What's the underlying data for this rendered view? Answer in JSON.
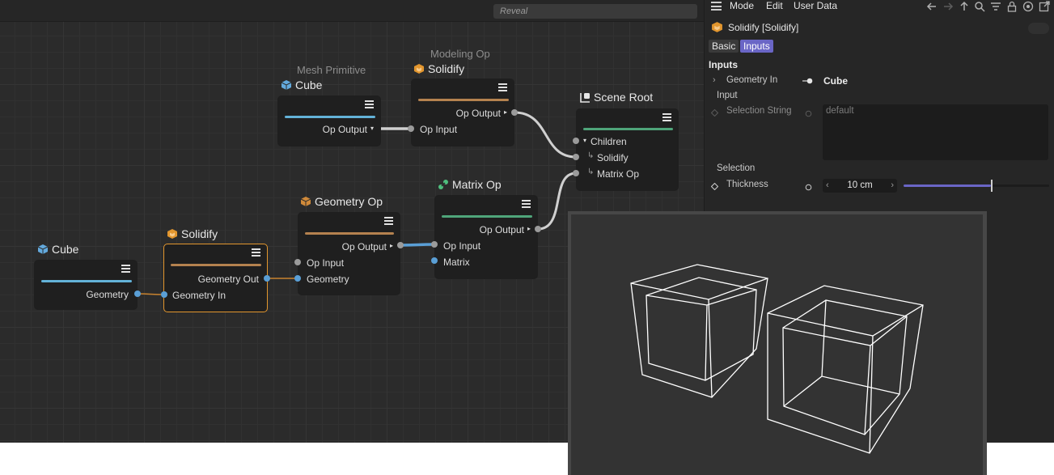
{
  "graph": {
    "reveal_label": "Reveal",
    "nodes": {
      "cube_left": {
        "title": "Cube",
        "outputs": [
          "Geometry"
        ]
      },
      "solidify_selected": {
        "title": "Solidify",
        "outputs": [
          "Geometry Out"
        ],
        "inputs": [
          "Geometry In"
        ]
      },
      "geometry_op": {
        "title": "Geometry Op",
        "outputs": [
          "Op Output"
        ],
        "inputs": [
          "Op Input",
          "Geometry"
        ]
      },
      "matrix_op": {
        "title": "Matrix Op",
        "outputs": [
          "Op Output"
        ],
        "inputs": [
          "Op Input",
          "Matrix"
        ]
      },
      "mesh_primitive": {
        "category": "Mesh Primitive",
        "title": "Cube",
        "outputs": [
          "Op Output"
        ]
      },
      "modeling_op": {
        "category": "Modeling Op",
        "title": "Solidify",
        "outputs": [
          "Op Output"
        ],
        "inputs": [
          "Op Input"
        ]
      },
      "scene_root": {
        "title": "Scene Root",
        "inputs": [
          "Children",
          "Solidify",
          "Matrix Op"
        ]
      }
    }
  },
  "attributes": {
    "menu": [
      "Mode",
      "Edit",
      "User Data"
    ],
    "toolbar_icons": [
      "back-arrow-icon",
      "forward-arrow-icon",
      "up-arrow-icon",
      "search-icon",
      "filter-icon",
      "lock-icon",
      "target-icon",
      "new-window-icon"
    ],
    "object_title": "Solidify [Solidify]",
    "tabs": [
      "Basic",
      "Inputs"
    ],
    "active_tab": "Inputs",
    "section_title": "Inputs",
    "geometry_in_label": "Geometry In",
    "geometry_in_value": "Cube",
    "input_group_label": "Input",
    "selection_string_label": "Selection String",
    "selection_string_value": "default",
    "selection_group_label": "Selection",
    "thickness_label": "Thickness",
    "thickness_value": "10 cm",
    "thickness_slider_fraction": 0.6
  },
  "colors": {
    "accent": "#6a66c6",
    "selected_border": "#e2962e",
    "bar_blue": "#63b2d8",
    "bar_orange": "#b5824f",
    "bar_green": "#4fa57a"
  }
}
